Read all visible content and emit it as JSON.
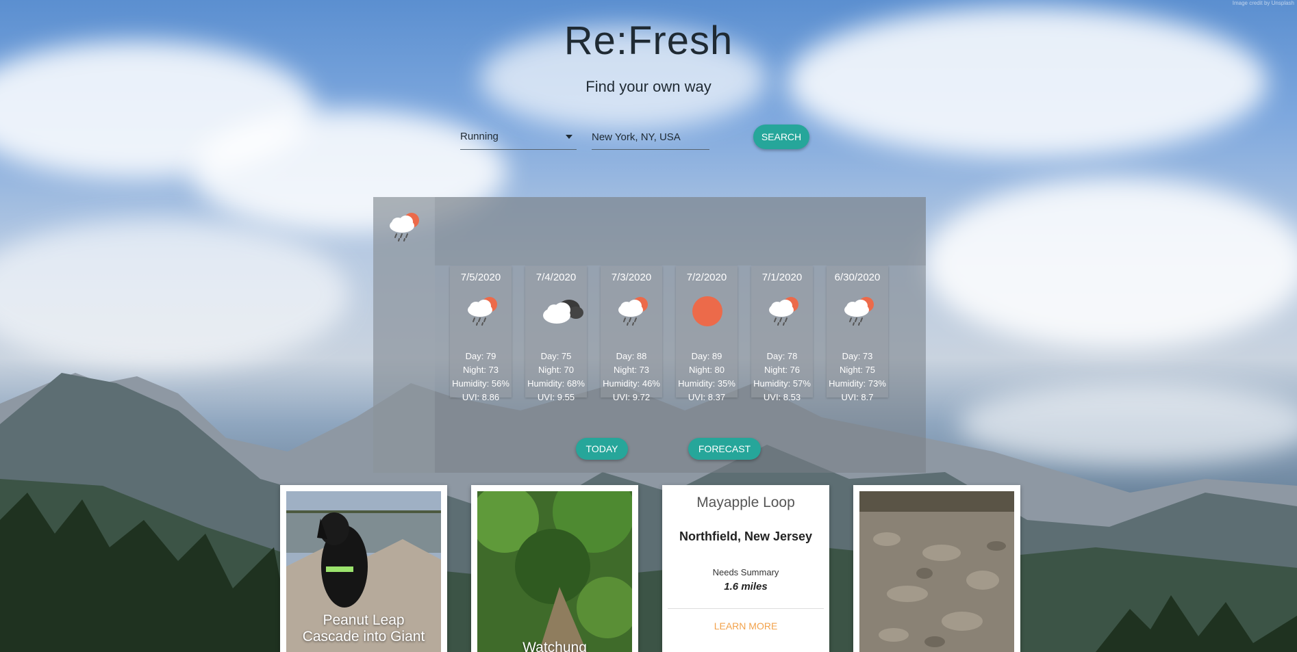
{
  "app": {
    "title": "Re:Fresh",
    "subtitle": "Find your own way",
    "credit": "Image credit by Unsplash"
  },
  "search": {
    "activity_value": "Running",
    "location_value": "New York, NY, USA",
    "button_label": "SEARCH"
  },
  "weather": {
    "today_icon": "rain-cloud-sun-icon",
    "days": [
      {
        "date": "7/5/2020",
        "icon": "rain-cloud-sun-icon",
        "day": "Day: 79",
        "night": "Night: 73",
        "humidity": "Humidity: 56%",
        "uvi": "UVI: 8.86"
      },
      {
        "date": "7/4/2020",
        "icon": "cloudy-icon",
        "day": "Day: 75",
        "night": "Night: 70",
        "humidity": "Humidity: 68%",
        "uvi": "UVI: 9.55"
      },
      {
        "date": "7/3/2020",
        "icon": "rain-cloud-sun-icon",
        "day": "Day: 88",
        "night": "Night: 73",
        "humidity": "Humidity: 46%",
        "uvi": "UVI: 9.72"
      },
      {
        "date": "7/2/2020",
        "icon": "sun-icon",
        "day": "Day: 89",
        "night": "Night: 80",
        "humidity": "Humidity: 35%",
        "uvi": "UVI: 8.37"
      },
      {
        "date": "7/1/2020",
        "icon": "rain-cloud-sun-icon",
        "day": "Day: 78",
        "night": "Night: 76",
        "humidity": "Humidity: 57%",
        "uvi": "UVI: 8.53"
      },
      {
        "date": "6/30/2020",
        "icon": "rain-cloud-sun-icon",
        "day": "Day: 73",
        "night": "Night: 75",
        "humidity": "Humidity: 73%",
        "uvi": "UVI: 8.7"
      }
    ],
    "today_label": "TODAY",
    "forecast_label": "FORECAST"
  },
  "trails": [
    {
      "kind": "image",
      "caption_line1": "Peanut Leap",
      "caption_line2": "Cascade into Giant"
    },
    {
      "kind": "image",
      "caption_line1": "Watchung",
      "caption_line2": ""
    },
    {
      "kind": "info",
      "name": "Mayapple Loop",
      "location": "Northfield, New Jersey",
      "summary": "Needs Summary",
      "length": "1.6 miles",
      "link_label": "LEARN MORE"
    },
    {
      "kind": "image",
      "caption_line1": "",
      "caption_line2": ""
    }
  ],
  "colors": {
    "accent": "#26a69a",
    "link": "#f2a24b",
    "sun": "#ec6a4a"
  }
}
